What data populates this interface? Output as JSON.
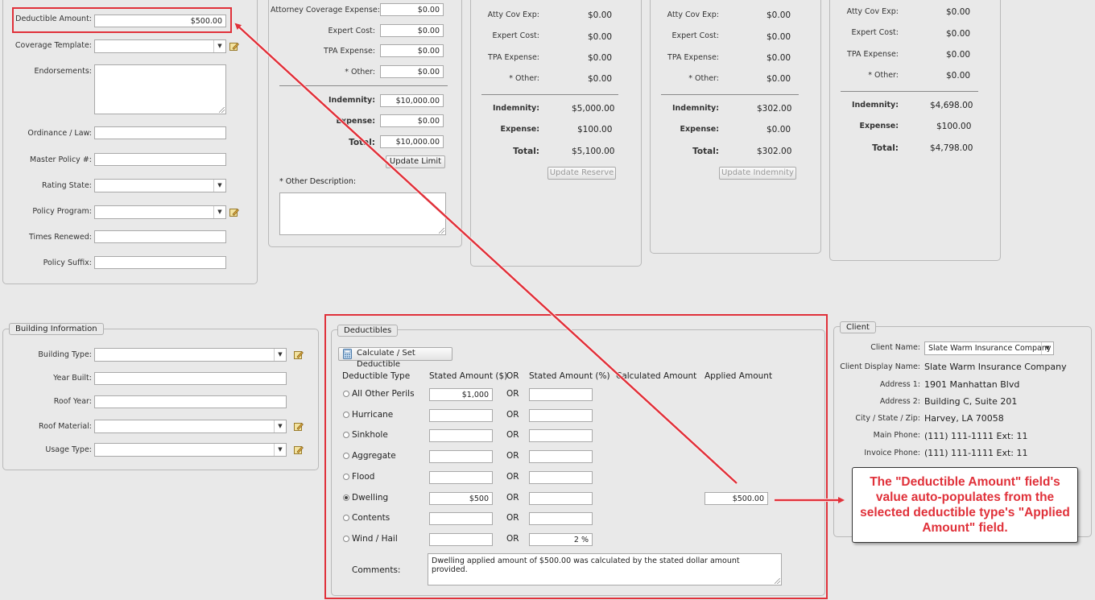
{
  "policy": {
    "deductible_amount_label": "Deductible Amount:",
    "deductible_amount_value": "$500.00",
    "coverage_template_label": "Coverage Template:",
    "endorsements_label": "Endorsements:",
    "ordinance_law_label": "Ordinance / Law:",
    "master_policy_label": "Master Policy #:",
    "rating_state_label": "Rating State:",
    "policy_program_label": "Policy Program:",
    "times_renewed_label": "Times Renewed:",
    "policy_suffix_label": "Policy Suffix:"
  },
  "limits": {
    "attorney_label": "Attorney Coverage Expense:",
    "attorney_value": "$0.00",
    "expert_label": "Expert Cost:",
    "expert_value": "$0.00",
    "tpa_label": "TPA Expense:",
    "tpa_value": "$0.00",
    "other_label": "* Other:",
    "other_value": "$0.00",
    "indemnity_label": "Indemnity:",
    "indemnity_value": "$10,000.00",
    "expense_label": "Expense:",
    "expense_value": "$0.00",
    "total_label": "Total:",
    "total_value": "$10,000.00",
    "update_button": "Update Limit",
    "other_desc_label": "* Other Description:"
  },
  "reserve": {
    "atty_label": "Atty Cov Exp:",
    "atty_value": "$0.00",
    "expert_label": "Expert Cost:",
    "expert_value": "$0.00",
    "tpa_label": "TPA Expense:",
    "tpa_value": "$0.00",
    "other_label": "* Other:",
    "other_value": "$0.00",
    "indemnity_label": "Indemnity:",
    "indemnity_value": "$5,000.00",
    "expense_label": "Expense:",
    "expense_value": "$100.00",
    "total_label": "Total:",
    "total_value": "$5,100.00",
    "update_button": "Update Reserve"
  },
  "indemnity_col": {
    "atty_label": "Atty Cov Exp:",
    "atty_value": "$0.00",
    "expert_label": "Expert Cost:",
    "expert_value": "$0.00",
    "tpa_label": "TPA Expense:",
    "tpa_value": "$0.00",
    "other_label": "* Other:",
    "other_value": "$0.00",
    "indemnity_label": "Indemnity:",
    "indemnity_value": "$302.00",
    "expense_label": "Expense:",
    "expense_value": "$0.00",
    "total_label": "Total:",
    "total_value": "$302.00",
    "update_button": "Update Indemnity"
  },
  "remaining_col": {
    "atty_label": "Atty Cov Exp:",
    "atty_value": "$0.00",
    "expert_label": "Expert Cost:",
    "expert_value": "$0.00",
    "tpa_label": "TPA Expense:",
    "tpa_value": "$0.00",
    "other_label": "* Other:",
    "other_value": "$0.00",
    "indemnity_label": "Indemnity:",
    "indemnity_value": "$4,698.00",
    "expense_label": "Expense:",
    "expense_value": "$100.00",
    "total_label": "Total:",
    "total_value": "$4,798.00"
  },
  "building": {
    "legend": "Building Information",
    "type_label": "Building Type:",
    "year_label": "Year Built:",
    "roof_year_label": "Roof Year:",
    "roof_material_label": "Roof Material:",
    "usage_label": "Usage Type:"
  },
  "deductibles": {
    "legend": "Deductibles",
    "calc_button": "Calculate / Set Deductible",
    "col_type": "Deductible Type",
    "col_stated_amount": "Stated Amount ($)",
    "col_or": "OR",
    "col_stated_pct": "Stated Amount (%)",
    "col_calculated": "Calculated Amount",
    "col_applied": "Applied Amount",
    "rows": [
      {
        "label": "All Other Perils",
        "amount": "$1,000",
        "or": "OR",
        "pct": "",
        "applied": ""
      },
      {
        "label": "Hurricane",
        "amount": "",
        "or": "OR",
        "pct": "",
        "applied": ""
      },
      {
        "label": "Sinkhole",
        "amount": "",
        "or": "OR",
        "pct": "",
        "applied": ""
      },
      {
        "label": "Aggregate",
        "amount": "",
        "or": "OR",
        "pct": "",
        "applied": ""
      },
      {
        "label": "Flood",
        "amount": "",
        "or": "OR",
        "pct": "",
        "applied": ""
      },
      {
        "label": "Dwelling",
        "amount": "$500",
        "or": "OR",
        "pct": "",
        "applied": "$500.00"
      },
      {
        "label": "Contents",
        "amount": "",
        "or": "OR",
        "pct": "",
        "applied": ""
      },
      {
        "label": "Wind / Hail",
        "amount": "",
        "or": "OR",
        "pct": "2 %",
        "applied": ""
      }
    ],
    "selected_row": 5,
    "comments_label": "Comments:",
    "comments_value": "Dwelling applied amount of $500.00 was calculated by the stated dollar amount provided."
  },
  "client": {
    "legend": "Client",
    "name_label": "Client Name:",
    "name_value": "Slate Warm Insurance Company",
    "display_label": "Client Display Name:",
    "display_value": "Slate Warm Insurance Company",
    "address1_label": "Address 1:",
    "address1_value": "1901 Manhattan Blvd",
    "address2_label": "Address 2:",
    "address2_value": "Building C, Suite 201",
    "city_label": "City / State / Zip:",
    "city_value": "Harvey, LA 70058",
    "main_phone_label": "Main Phone:",
    "main_phone_value": "(111) 111-1111 Ext: 11",
    "invoice_phone_label": "Invoice Phone:",
    "invoice_phone_value": "(111) 111-1111 Ext: 11"
  },
  "callout": {
    "text": "The \"Deductible Amount\" field's value auto-populates from the selected deductible type's \"Applied Amount\" field."
  },
  "colors": {
    "annotation_red": "#e0313a",
    "panel_bg": "#e9e9e9"
  }
}
